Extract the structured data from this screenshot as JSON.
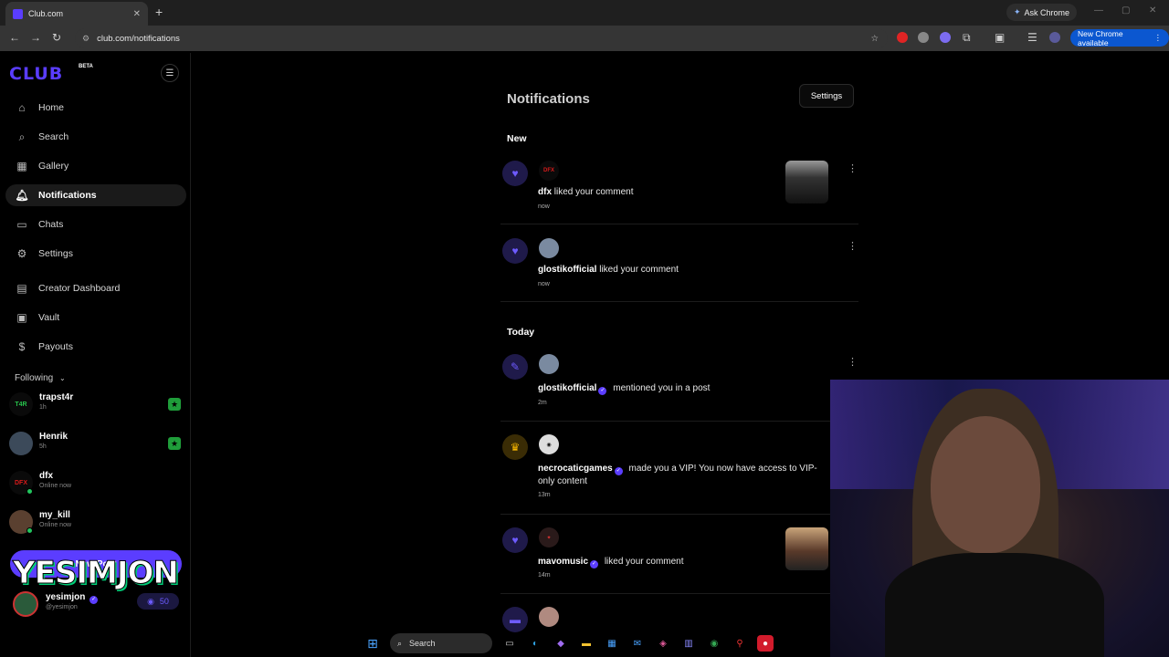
{
  "browser": {
    "tab_title": "Club.com",
    "new_tab_symbol": "+",
    "close_tab_symbol": "✕",
    "ask_chrome_label": "Ask Chrome",
    "url": "club.com/notifications",
    "new_chrome_label": "New Chrome available"
  },
  "sidebar": {
    "logo": "CLUB",
    "beta_label": "BETA",
    "nav": [
      {
        "label": "Home",
        "icon": "home-icon"
      },
      {
        "label": "Search",
        "icon": "search-icon"
      },
      {
        "label": "Gallery",
        "icon": "gallery-icon"
      },
      {
        "label": "Notifications",
        "icon": "bell-icon"
      },
      {
        "label": "Chats",
        "icon": "chat-icon"
      },
      {
        "label": "Settings",
        "icon": "gear-icon"
      },
      {
        "label": "Creator Dashboard",
        "icon": "dashboard-icon"
      },
      {
        "label": "Vault",
        "icon": "vault-icon"
      },
      {
        "label": "Payouts",
        "icon": "dollar-icon"
      }
    ],
    "following_label": "Following",
    "following": [
      {
        "name": "trapst4r",
        "sub": "1h"
      },
      {
        "name": "Henrik",
        "sub": "5h"
      },
      {
        "name": "dfx",
        "sub": "Online now"
      },
      {
        "name": "my_kill",
        "sub": "Online now"
      }
    ],
    "new_post_label": "New Post",
    "me": {
      "name": "yesimjon",
      "handle": "@yesimjon",
      "credits": "50"
    }
  },
  "overlay": {
    "watermark": "YESIMJON"
  },
  "main": {
    "title": "Notifications",
    "settings_label": "Settings",
    "section_new": "New",
    "section_today": "Today",
    "notifications": [
      {
        "user": "dfx",
        "action": "liked your comment",
        "time": "now",
        "type": "heart-icon"
      },
      {
        "user": "glostikofficial",
        "action": "liked your comment",
        "time": "now",
        "type": "heart-icon"
      },
      {
        "user": "glostikofficial",
        "action": "mentioned you in a post",
        "time": "2m",
        "type": "pencil-icon"
      },
      {
        "user": "necrocaticgames",
        "action": "made you a VIP! You now have access to VIP-only content",
        "time": "13m",
        "type": "crown-icon"
      },
      {
        "user": "mavomusic",
        "action": "liked your comment",
        "time": "14m",
        "type": "heart-icon"
      }
    ]
  },
  "taskbar": {
    "search_label": "Search"
  },
  "colors": {
    "accent": "#5b3dff",
    "online": "#22c55e",
    "badge_green": "#1f9d3a"
  }
}
